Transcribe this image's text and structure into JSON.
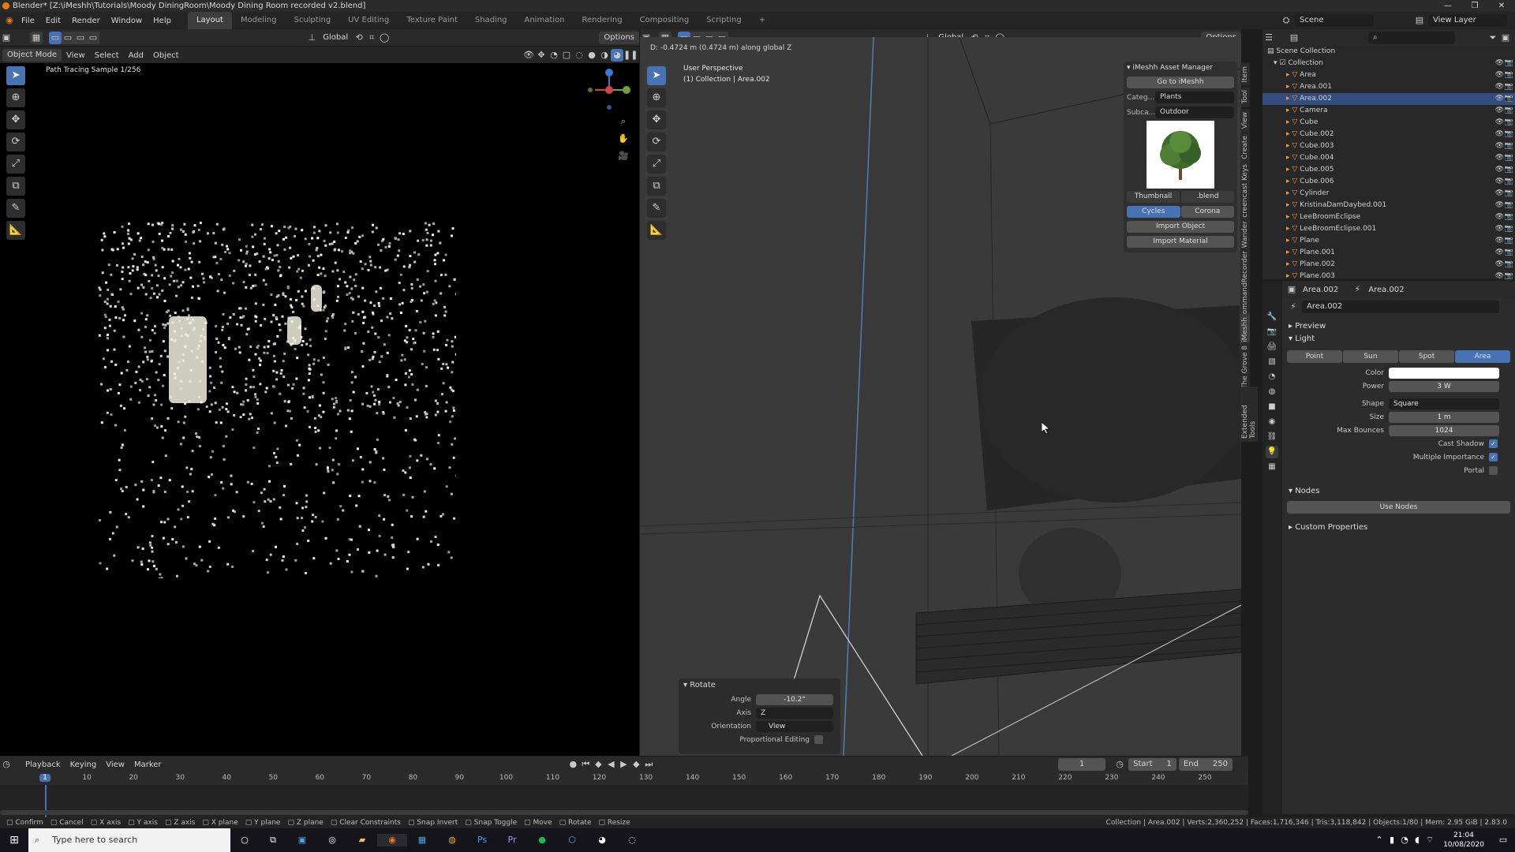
{
  "window": {
    "title": "Blender* [Z:\\iMeshh\\Tutorials\\Moody DiningRoom\\Moody Dining Room recorded v2.blend]",
    "controls": [
      "—",
      "❐",
      "✕"
    ]
  },
  "menu": {
    "items": [
      "File",
      "Edit",
      "Render",
      "Window",
      "Help"
    ],
    "workspaces": [
      "Layout",
      "Modeling",
      "Sculpting",
      "UV Editing",
      "Texture Paint",
      "Shading",
      "Animation",
      "Rendering",
      "Compositing",
      "Scripting"
    ],
    "active_workspace": "Layout",
    "add_tab": "+",
    "scene": "Scene",
    "view_layer": "View Layer"
  },
  "left_viewport": {
    "header": {
      "orientation": "Global",
      "options": "Options"
    },
    "header2": {
      "mode": "Object Mode",
      "menus": [
        "View",
        "Select",
        "Add",
        "Object"
      ]
    },
    "status_text": "Path Tracing Sample 1/256"
  },
  "right_viewport": {
    "header": {
      "orientation": "Global",
      "options": "Options"
    },
    "info_line": "D: -0.4724 m (0.4724 m) along global Z",
    "perspective": "User Perspective",
    "collection_label": "(1) Collection | Area.002",
    "side_tabs": [
      "Item",
      "Tool",
      "View",
      "Create",
      "Screencast Keys",
      "Wander",
      "CommandRecorder",
      "iMeshh",
      "The Grove 8",
      "Extended Tools"
    ]
  },
  "asset_manager": {
    "title": "iMeshh Asset Manager",
    "go_button": "Go to iMeshh",
    "category_label": "Categ...",
    "category_value": "Plants",
    "subcategory_label": "Subca...",
    "subcategory_value": "Outdoor",
    "thumbnail_label": "Thumbnail",
    "blend_label": ".blend",
    "engines": [
      "Cycles",
      "Corona"
    ],
    "active_engine": "Cycles",
    "import_object": "Import Object",
    "import_material": "Import Material"
  },
  "rotate_panel": {
    "title": "Rotate",
    "angle_label": "Angle",
    "angle_value": "-10.2°",
    "axis_label": "Axis",
    "axis_value": "Z",
    "orientation_label": "Orientation",
    "orientation_value": "View",
    "proportional_label": "Proportional Editing"
  },
  "outliner": {
    "root": "Scene Collection",
    "collection": "Collection",
    "items": [
      {
        "name": "Area",
        "selected": false
      },
      {
        "name": "Area.001",
        "selected": false
      },
      {
        "name": "Area.002",
        "selected": true
      },
      {
        "name": "Camera",
        "selected": false
      },
      {
        "name": "Cube",
        "selected": false
      },
      {
        "name": "Cube.002",
        "selected": false
      },
      {
        "name": "Cube.003",
        "selected": false
      },
      {
        "name": "Cube.004",
        "selected": false
      },
      {
        "name": "Cube.005",
        "selected": false
      },
      {
        "name": "Cube.006",
        "selected": false
      },
      {
        "name": "Cylinder",
        "selected": false
      },
      {
        "name": "KristinaDamDaybed.001",
        "selected": false
      },
      {
        "name": "LeeBroomEclipse",
        "selected": false
      },
      {
        "name": "LeeBroomEclipse.001",
        "selected": false
      },
      {
        "name": "Plane",
        "selected": false
      },
      {
        "name": "Plane.001",
        "selected": false
      },
      {
        "name": "Plane.002",
        "selected": false
      },
      {
        "name": "Plane.003",
        "selected": false
      }
    ]
  },
  "properties": {
    "object_name": "Area.002",
    "data_name": "Area.002",
    "light_data": "Area.002",
    "preview_section": "Preview",
    "light_section": "Light",
    "light_types": [
      "Point",
      "Sun",
      "Spot",
      "Area"
    ],
    "active_light_type": "Area",
    "color_label": "Color",
    "power_label": "Power",
    "power_value": "3 W",
    "shape_label": "Shape",
    "shape_value": "Square",
    "size_label": "Size",
    "size_value": "1 m",
    "max_bounces_label": "Max Bounces",
    "max_bounces_value": "1024",
    "cast_shadow_label": "Cast Shadow",
    "multiple_importance_label": "Multiple Importance",
    "portal_label": "Portal",
    "nodes_section": "Nodes",
    "use_nodes": "Use Nodes",
    "custom_properties": "Custom Properties"
  },
  "timeline": {
    "menus": [
      "Playback",
      "Keying",
      "View",
      "Marker"
    ],
    "current_frame": "1",
    "start_label": "Start",
    "start_value": "1",
    "end_label": "End",
    "end_value": "250",
    "ticks": [
      "1",
      "10",
      "20",
      "30",
      "40",
      "50",
      "60",
      "70",
      "80",
      "90",
      "100",
      "110",
      "120",
      "130",
      "140",
      "150",
      "160",
      "170",
      "180",
      "190",
      "200",
      "210",
      "220",
      "230",
      "240",
      "250"
    ]
  },
  "statusbar": {
    "hints": [
      "Confirm",
      "Cancel",
      "X axis",
      "Y axis",
      "Z axis",
      "X plane",
      "Y plane",
      "Z plane",
      "Clear Constraints",
      "Snap Invert",
      "Snap Toggle",
      "Move",
      "Rotate",
      "Resize"
    ],
    "stats": "Collection | Area.002 | Verts:2,360,252 | Faces:1,716,346 | Tris:3,118,842 | Objects:1/80 | Mem: 2.95 GiB | 2.83.0"
  },
  "taskbar": {
    "search_placeholder": "Type here to search",
    "time": "21:04",
    "date": "10/08/2020"
  },
  "colors": {
    "accent": "#4772b3",
    "selected_row": "#334d80",
    "blender_orange": "#e87d0d"
  }
}
